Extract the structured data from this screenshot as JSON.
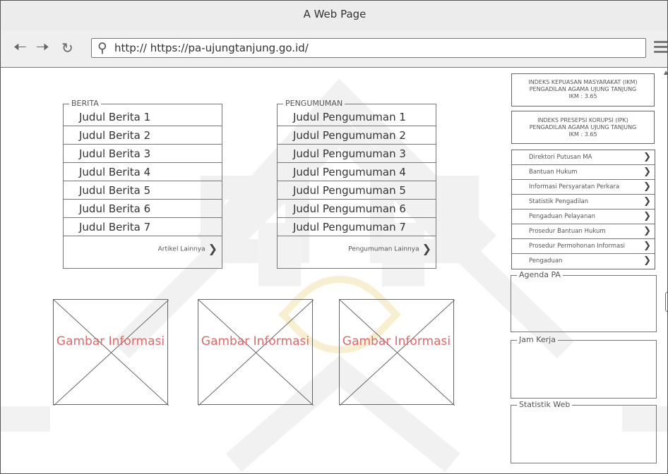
{
  "window": {
    "title": "A Web Page"
  },
  "navbar": {
    "url": "http:// https://pa-ujungtanjung.go.id/"
  },
  "berita": {
    "legend": "BERITA",
    "items": [
      "Judul Berita 1",
      "Judul Berita 2",
      "Judul Berita 3",
      "Judul Berita 4",
      "Judul Berita 5",
      "Judul Berita 6",
      "Judul Berita 7"
    ],
    "more": "Artikel Lainnya"
  },
  "pengumuman": {
    "legend": "PENGUMUMAN",
    "items": [
      "Judul Pengumuman 1",
      "Judul Pengumuman 2",
      "Judul Pengumuman 3",
      "Judul Pengumuman 4",
      "Judul Pengumuman 5",
      "Judul Pengumuman 6",
      "Judul Pengumuman 7"
    ],
    "more": "Pengumuman Lainnya"
  },
  "images": [
    "Gambar Informasi",
    "Gambar Informasi",
    "Gambar Informasi"
  ],
  "sidebar": {
    "ikm": {
      "line1": "INDEKS KEPUASAN MASYARAKAT (IKM)",
      "line2": "PENGADILAN AGAMA UJUNG TANJUNG",
      "line3": "IKM : 3.65"
    },
    "ipk": {
      "line1": "INDEKS PRESEPSI KORUPSI (IPK)",
      "line2": "PENGADILAN AGAMA UJUNG TANJUNG",
      "line3": "IKM : 3.65"
    },
    "links": [
      "Direktori Putusan MA",
      "Bantuan Hukum",
      "Informasi Persyaratan Perkara",
      "Statistik Pengadilan",
      "Pengaduan Pelayanan",
      "Prosedur Bantuan Hukum",
      "Prosedur Permohonan Informasi",
      "Pengaduan"
    ],
    "agenda": "Agenda PA",
    "jam_kerja": "Jam Kerja",
    "statistik": "Statistik Web"
  }
}
